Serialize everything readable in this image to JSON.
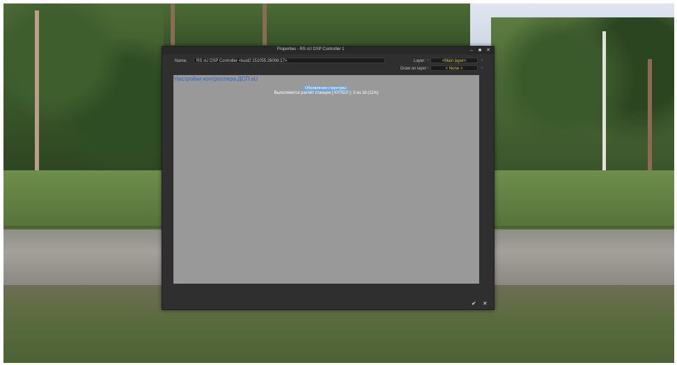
{
  "window": {
    "title": "Properties - RS sU DSP Controller 1",
    "controls": {
      "minimize": "–",
      "maximize": "■",
      "close": "✕"
    }
  },
  "fields": {
    "name_label": "Name:",
    "name_value": "RS sU DSP Controller  <kuid2:151055:26008:17>",
    "layer_label": "Layer:",
    "layer_value": "<Main layer>",
    "layer_dot": "○",
    "draw_label": "Draw on layer:",
    "draw_value": "< None >",
    "draw_dot": "○"
  },
  "panel": {
    "heading": "Настройки контроллера ДСП sU",
    "tag": "Обновление структуры",
    "progress_text": "Выполняется расчёт станции [ КУПОЛ ]: 3 из 18 (11%)"
  },
  "footer": {
    "ok": "✔",
    "cancel": "✕"
  },
  "colors": {
    "window_bg": "#2f2f2f",
    "panel_bg": "#999999",
    "heading": "#2d67c9",
    "tag_bg": "#6fa7dc",
    "field_accent": "#d7d54a"
  }
}
